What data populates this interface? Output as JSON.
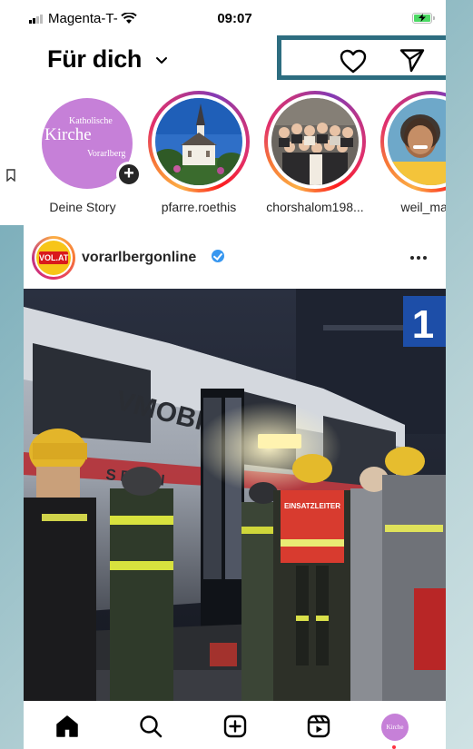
{
  "status_bar": {
    "carrier": "Magenta-T-",
    "time": "09:07"
  },
  "header": {
    "title": "Für dich"
  },
  "stories": [
    {
      "label": "Deine Story",
      "avatar_lines": [
        "Katholische",
        "Kirche",
        "Vorarlberg"
      ],
      "own": true
    },
    {
      "label": "pfarre.roethis"
    },
    {
      "label": "chorshalom198..."
    },
    {
      "label": "weil_ma_g"
    }
  ],
  "post": {
    "username": "vorarlbergonline",
    "avatar_text": "VOL.AT",
    "image_texts": {
      "platform_number": "1",
      "train_text": "VMOBIL",
      "vest_text": "EINSATZLEITER",
      "fleet_text": "S BAHN"
    }
  },
  "bottom_nav": {
    "items": [
      "home-icon",
      "search-icon",
      "create-icon",
      "reels-icon",
      "profile-avatar"
    ],
    "profile_avatar_text": "Kirche"
  },
  "colors": {
    "accent_frame": "#2d6d80",
    "verified_blue": "#3797f0",
    "avatar_purple": "#c680d8"
  }
}
